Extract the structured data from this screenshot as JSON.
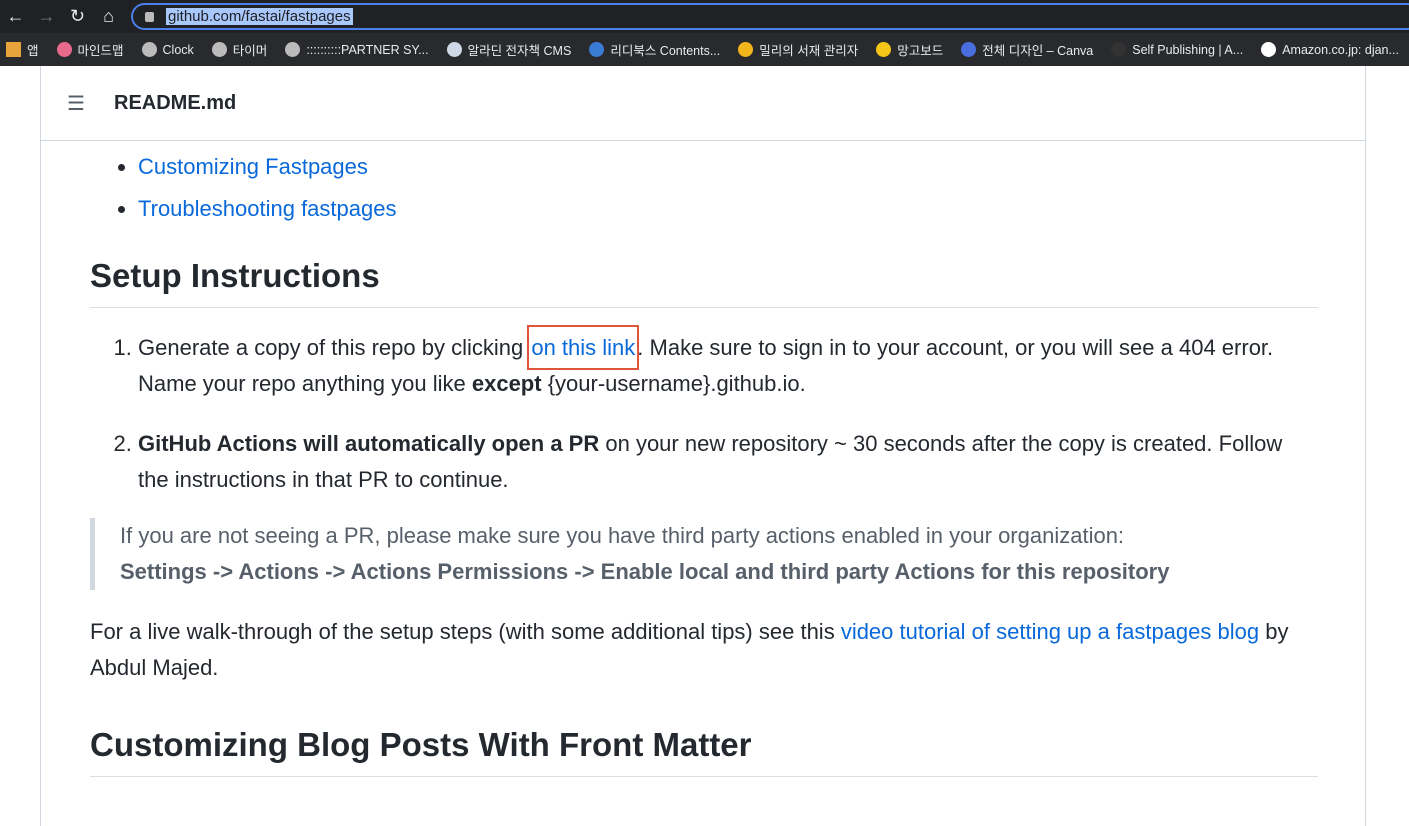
{
  "browser": {
    "url": "github.com/fastai/fastpages",
    "bookmarks": [
      {
        "label": "앱",
        "color": "#e8a33d"
      },
      {
        "label": "마인드맵",
        "color": "#ea6a8e"
      },
      {
        "label": "Clock",
        "color": "#bbbbbb"
      },
      {
        "label": "타이머",
        "color": "#bbbbbb"
      },
      {
        "label": "::::::::::PARTNER SY...",
        "color": "#bbbbbb"
      },
      {
        "label": "알라딘 전자책 CMS",
        "color": "#cfd8e6"
      },
      {
        "label": "리디북스 Contents...",
        "color": "#3a7bd5"
      },
      {
        "label": "밀리의 서재 관리자",
        "color": "#f2b51c"
      },
      {
        "label": "망고보드",
        "color": "#f5c518"
      },
      {
        "label": "전체 디자인 – Canva",
        "color": "#4a6ee0"
      },
      {
        "label": "Self Publishing | A...",
        "color": "#333333"
      },
      {
        "label": "Amazon.co.jp: djan...",
        "color": "#ffffff"
      }
    ]
  },
  "readme": {
    "filename": "README.md",
    "toc": [
      "Customizing Fastpages",
      "Troubleshooting fastpages"
    ],
    "h_setup": "Setup Instructions",
    "step1": {
      "a": "Generate a copy of this repo by clicking ",
      "link": "on this link",
      "b": ". Make sure to sign in to your account, or you will see a 404 error. Name your repo anything you like ",
      "bold": "except",
      "c": " {your-username}.github.io."
    },
    "step2": {
      "bold": "GitHub Actions will automatically open a PR",
      "rest": " on your new repository ~ 30 seconds after the copy is created. Follow the instructions in that PR to continue."
    },
    "quote": {
      "text": "If you are not seeing a PR, please make sure you have third party actions enabled in your organization:",
      "bold": "Settings -> Actions -> Actions Permissions -> Enable local and third party Actions for this repository"
    },
    "para": {
      "a": "For a live walk-through of the setup steps (with some additional tips) see this ",
      "link": "video tutorial of setting up a fastpages blog",
      "b": " by Abdul Majed."
    },
    "h_custom": "Customizing Blog Posts With Front Matter"
  }
}
